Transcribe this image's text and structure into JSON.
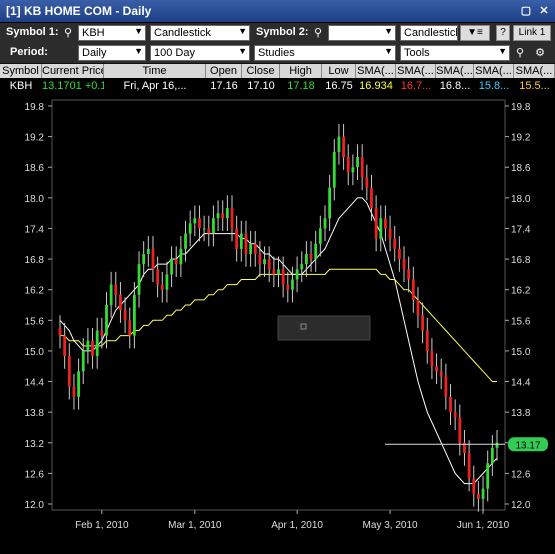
{
  "window": {
    "title": "[1] KB HOME COM - Daily",
    "controls": [
      "▢",
      "✕"
    ]
  },
  "row1": {
    "symbol1_label": "Symbol 1:",
    "symbol1_value": "KBH",
    "type1_value": "Candlestick",
    "symbol2_label": "Symbol 2:",
    "symbol2_value": "",
    "type2_value": "Candlestick",
    "help_label": "?",
    "link_label": "Link 1"
  },
  "row2": {
    "period_label": "Period:",
    "period_value": "Daily",
    "range_value": "100 Day",
    "studies_value": "Studies",
    "tools_value": "Tools"
  },
  "quote": {
    "headers": [
      "Symbol",
      "Current Price",
      "Time",
      "Open",
      "Close",
      "High",
      "Low",
      "SMA(...",
      "SMA(...",
      "SMA(...",
      "SMA(...",
      "SMA(..."
    ],
    "values": [
      "KBH",
      "13.1701 +0.1...",
      "Fri, Apr 16,...",
      "17.16",
      "17.10",
      "17.18",
      "16.75",
      "16.934",
      "16.7...",
      "16.8...",
      "15.8...",
      "15.5..."
    ],
    "colors": [
      "#ffffff",
      "#33dd33",
      "#ffffff",
      "#ffffff",
      "#ffffff",
      "#33dd33",
      "#ffffff",
      "#ffff33",
      "#ff3333",
      "#ffffff",
      "#33ccff",
      "#ffcc33"
    ]
  },
  "chart_data": {
    "type": "candlestick",
    "y_ticks": [
      "19.8",
      "19.2",
      "18.6",
      "18.0",
      "17.4",
      "16.8",
      "16.2",
      "15.6",
      "15.0",
      "14.4",
      "13.8",
      "13.2",
      "12.6",
      "12.0"
    ],
    "ylim": [
      12.0,
      19.8
    ],
    "x_ticks": [
      "Feb 1, 2010",
      "Mar 1, 2010",
      "Apr 1, 2010",
      "May 3, 2010",
      "Jun 1, 2010"
    ],
    "x_tick_index": [
      9,
      29,
      51,
      71,
      91
    ],
    "last_price_label": "13.17",
    "last_price": 13.17,
    "colors": {
      "up": "#33dd33",
      "down": "#ee2222",
      "sma1": "#ffffff",
      "sma2": "#ffff55",
      "sma3": "#ee2222",
      "sma4": "#33ccff",
      "sma5": "#ffcc33"
    },
    "closes": [
      15.3,
      14.9,
      14.3,
      14.1,
      14.6,
      15.0,
      15.2,
      14.9,
      15.4,
      15.3,
      15.9,
      16.3,
      16.1,
      15.8,
      15.6,
      15.3,
      16.1,
      16.7,
      16.9,
      17.0,
      16.6,
      16.3,
      16.2,
      16.5,
      16.8,
      16.7,
      17.0,
      17.3,
      17.5,
      17.6,
      17.4,
      17.4,
      17.3,
      17.6,
      17.7,
      17.6,
      17.8,
      17.4,
      17.0,
      17.3,
      16.9,
      17.1,
      16.9,
      16.7,
      16.8,
      16.6,
      16.5,
      16.6,
      16.3,
      16.2,
      16.4,
      16.6,
      16.7,
      16.9,
      16.8,
      17.1,
      17.4,
      17.6,
      18.2,
      18.9,
      19.2,
      18.8,
      18.5,
      18.6,
      18.8,
      18.4,
      18.2,
      17.8,
      17.2,
      17.6,
      17.4,
      17.2,
      17.0,
      16.8,
      16.6,
      16.4,
      16.0,
      15.7,
      15.4,
      15.0,
      14.7,
      14.6,
      14.5,
      14.1,
      13.8,
      13.7,
      13.2,
      13.0,
      12.5,
      12.2,
      12.1,
      12.3,
      12.8,
      13.1,
      13.2
    ],
    "sma_white": [
      15.6,
      15.5,
      15.4,
      15.2,
      15.1,
      15.0,
      15.0,
      15.0,
      15.1,
      15.2,
      15.4,
      15.6,
      15.8,
      15.9,
      16.0,
      16.1,
      16.2,
      16.3,
      16.5,
      16.6,
      16.6,
      16.7,
      16.7,
      16.7,
      16.8,
      16.8,
      16.9,
      16.9,
      17.0,
      17.1,
      17.2,
      17.3,
      17.3,
      17.3,
      17.3,
      17.3,
      17.3,
      17.3,
      17.3,
      17.2,
      17.2,
      17.1,
      17.1,
      17.0,
      16.9,
      16.9,
      16.8,
      16.8,
      16.7,
      16.6,
      16.5,
      16.5,
      16.5,
      16.6,
      16.7,
      16.8,
      16.9,
      17.0,
      17.2,
      17.4,
      17.6,
      17.7,
      17.8,
      17.9,
      18.0,
      18.0,
      17.9,
      17.7,
      17.5,
      17.3,
      17.0,
      16.7,
      16.4,
      16.0,
      15.6,
      15.2,
      14.8,
      14.4,
      14.1,
      13.8,
      13.6,
      13.4,
      13.2,
      13.0,
      12.8,
      12.6,
      12.5,
      12.4,
      12.4,
      12.4,
      12.5,
      12.6,
      12.7,
      12.8,
      12.9
    ],
    "sma_yellow": [
      15.3,
      15.3,
      15.2,
      15.2,
      15.2,
      15.1,
      15.1,
      15.1,
      15.1,
      15.1,
      15.2,
      15.2,
      15.2,
      15.3,
      15.3,
      15.3,
      15.4,
      15.4,
      15.5,
      15.5,
      15.6,
      15.6,
      15.6,
      15.7,
      15.7,
      15.8,
      15.8,
      15.9,
      15.9,
      16.0,
      16.0,
      16.0,
      16.1,
      16.1,
      16.2,
      16.2,
      16.3,
      16.3,
      16.3,
      16.4,
      16.4,
      16.4,
      16.4,
      16.5,
      16.5,
      16.5,
      16.5,
      16.5,
      16.5,
      16.5,
      16.5,
      16.5,
      16.5,
      16.5,
      16.5,
      16.5,
      16.5,
      16.5,
      16.6,
      16.6,
      16.6,
      16.6,
      16.6,
      16.6,
      16.6,
      16.6,
      16.6,
      16.6,
      16.6,
      16.5,
      16.5,
      16.4,
      16.4,
      16.3,
      16.2,
      16.2,
      16.1,
      16.0,
      15.9,
      15.8,
      15.7,
      15.6,
      15.5,
      15.4,
      15.3,
      15.2,
      15.1,
      15.0,
      14.9,
      14.8,
      14.7,
      14.6,
      14.5,
      14.4,
      14.4
    ]
  }
}
